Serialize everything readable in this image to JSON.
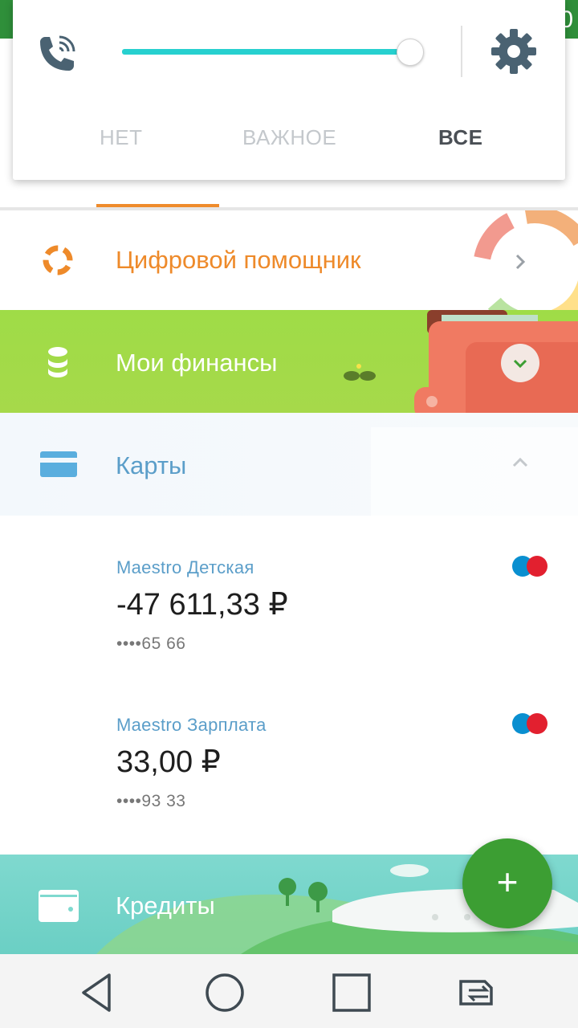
{
  "status_bar": {
    "edge_digit": "0",
    "color": "#2f8f3a"
  },
  "notification_popup": {
    "icons": {
      "left": "phone-volume-icon",
      "right": "gear-icon"
    },
    "slider_level": 1.0,
    "segments": [
      {
        "label": "НЕТ",
        "active": false
      },
      {
        "label": "ВАЖНОЕ",
        "active": false
      },
      {
        "label": "ВСЕ",
        "active": true
      }
    ],
    "accent_color": "#27d0cf"
  },
  "sections": {
    "assistant": {
      "label": "Цифровой помощник",
      "icon": "assistant-ring-icon",
      "color": "#ee8a2a"
    },
    "finances": {
      "label": "Мои финансы",
      "icon": "coins-stack-icon"
    },
    "cards": {
      "label": "Карты",
      "icon": "credit-card-icon"
    },
    "credits": {
      "label": "Кредиты",
      "icon": "wallet-icon"
    }
  },
  "cards": [
    {
      "name": "Maestro Детская",
      "amount": "-47 611,33 ₽",
      "mask": "••••65 66"
    },
    {
      "name": "Maestro Зарплата",
      "amount": "33,00 ₽",
      "mask": "••••93 33"
    }
  ],
  "fab": {
    "label": "+"
  },
  "navigation": [
    "back-icon",
    "home-icon",
    "recents-icon",
    "switch-sim-icon"
  ]
}
